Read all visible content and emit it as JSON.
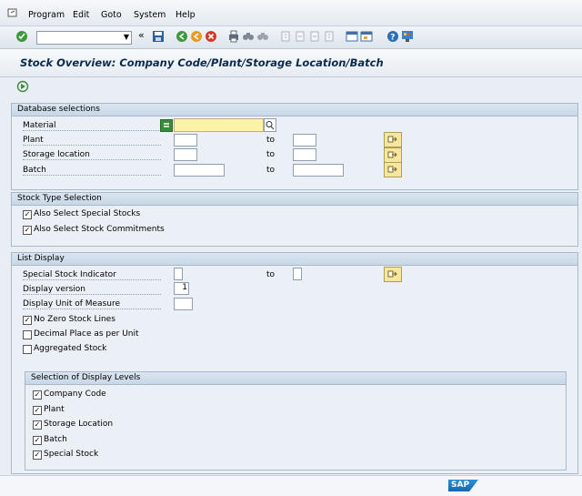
{
  "menubar": {
    "items": [
      {
        "label": "Program"
      },
      {
        "label": "Edit"
      },
      {
        "label": "Goto"
      },
      {
        "label": "System"
      },
      {
        "label": "Help"
      }
    ]
  },
  "toolbar": {
    "command_value": "",
    "icons": [
      "enter-icon",
      "save-icon",
      "back-icon",
      "exit-icon",
      "cancel-icon",
      "print-icon",
      "find-icon",
      "find-next-icon",
      "first-page-icon",
      "prev-page-icon",
      "next-page-icon",
      "last-page-icon",
      "new-session-icon",
      "shortcut-icon",
      "help-icon",
      "layout-icon"
    ]
  },
  "page": {
    "title": "Stock Overview: Company Code/Plant/Storage Location/Batch"
  },
  "db_selections": {
    "header": "Database selections",
    "to_label": "to",
    "rows": [
      {
        "label": "Material",
        "value": "",
        "to_value": ""
      },
      {
        "label": "Plant",
        "value": "",
        "to_value": ""
      },
      {
        "label": "Storage location",
        "value": "",
        "to_value": ""
      },
      {
        "label": "Batch",
        "value": "",
        "to_value": ""
      }
    ]
  },
  "stock_type": {
    "header": "Stock Type Selection",
    "checkboxes": [
      {
        "label": "Also Select Special Stocks",
        "checked": true
      },
      {
        "label": "Also Select Stock Commitments",
        "checked": true
      }
    ]
  },
  "list_display": {
    "header": "List Display",
    "special_stock_label": "Special Stock Indicator",
    "special_stock_value": "",
    "to_label": "to",
    "display_version_label": "Display version",
    "display_version_value": "1",
    "uom_label": "Display Unit of Measure",
    "uom_value": "",
    "checkboxes": [
      {
        "label": "No Zero Stock Lines",
        "checked": true
      },
      {
        "label": "Decimal Place as per Unit",
        "checked": false
      },
      {
        "label": "Aggregated Stock",
        "checked": false
      }
    ]
  },
  "display_levels": {
    "header": "Selection of Display Levels",
    "checkboxes": [
      {
        "label": "Company Code",
        "checked": true
      },
      {
        "label": "Plant",
        "checked": true
      },
      {
        "label": "Storage Location",
        "checked": true
      },
      {
        "label": "Batch",
        "checked": true
      },
      {
        "label": "Special Stock",
        "checked": true
      }
    ]
  },
  "footer": {
    "logo": "SAP"
  }
}
